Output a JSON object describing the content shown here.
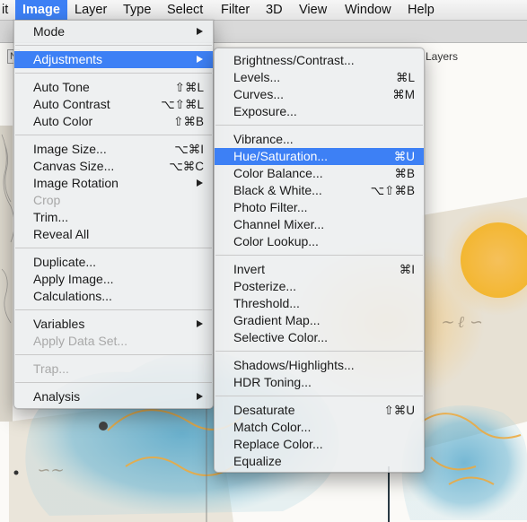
{
  "menubar": {
    "items": [
      "it",
      "Image",
      "Layer",
      "Type",
      "Select",
      "Filter",
      "3D",
      "View",
      "Window",
      "Help"
    ],
    "active_index": 1
  },
  "options_bar": {
    "left_box_text": "N",
    "layers_text": "Layers"
  },
  "image_menu": {
    "items": [
      {
        "label": "Mode",
        "submenu": true
      },
      {
        "separator": true
      },
      {
        "label": "Adjustments",
        "submenu": true,
        "highlighted": true
      },
      {
        "separator": true
      },
      {
        "label": "Auto Tone",
        "shortcut": "⇧⌘L"
      },
      {
        "label": "Auto Contrast",
        "shortcut": "⌥⇧⌘L"
      },
      {
        "label": "Auto Color",
        "shortcut": "⇧⌘B"
      },
      {
        "separator": true
      },
      {
        "label": "Image Size...",
        "shortcut": "⌥⌘I"
      },
      {
        "label": "Canvas Size...",
        "shortcut": "⌥⌘C"
      },
      {
        "label": "Image Rotation",
        "submenu": true
      },
      {
        "label": "Crop",
        "disabled": true
      },
      {
        "label": "Trim..."
      },
      {
        "label": "Reveal All"
      },
      {
        "separator": true
      },
      {
        "label": "Duplicate..."
      },
      {
        "label": "Apply Image..."
      },
      {
        "label": "Calculations..."
      },
      {
        "separator": true
      },
      {
        "label": "Variables",
        "submenu": true
      },
      {
        "label": "Apply Data Set...",
        "disabled": true
      },
      {
        "separator": true
      },
      {
        "label": "Trap...",
        "disabled": true
      },
      {
        "separator": true
      },
      {
        "label": "Analysis",
        "submenu": true
      }
    ]
  },
  "adjustments_menu": {
    "items": [
      {
        "label": "Brightness/Contrast..."
      },
      {
        "label": "Levels...",
        "shortcut": "⌘L"
      },
      {
        "label": "Curves...",
        "shortcut": "⌘M"
      },
      {
        "label": "Exposure..."
      },
      {
        "separator": true
      },
      {
        "label": "Vibrance..."
      },
      {
        "label": "Hue/Saturation...",
        "shortcut": "⌘U",
        "highlighted": true
      },
      {
        "label": "Color Balance...",
        "shortcut": "⌘B"
      },
      {
        "label": "Black & White...",
        "shortcut": "⌥⇧⌘B"
      },
      {
        "label": "Photo Filter..."
      },
      {
        "label": "Channel Mixer..."
      },
      {
        "label": "Color Lookup..."
      },
      {
        "separator": true
      },
      {
        "label": "Invert",
        "shortcut": "⌘I"
      },
      {
        "label": "Posterize..."
      },
      {
        "label": "Threshold..."
      },
      {
        "label": "Gradient Map..."
      },
      {
        "label": "Selective Color..."
      },
      {
        "separator": true
      },
      {
        "label": "Shadows/Highlights..."
      },
      {
        "label": "HDR Toning..."
      },
      {
        "separator": true
      },
      {
        "label": "Desaturate",
        "shortcut": "⇧⌘U"
      },
      {
        "label": "Match Color..."
      },
      {
        "label": "Replace Color..."
      },
      {
        "label": "Equalize"
      }
    ]
  },
  "colors": {
    "highlight": "#3d80f5",
    "menu_bg": "#eceef0",
    "disabled_text": "#a8a8a8"
  }
}
